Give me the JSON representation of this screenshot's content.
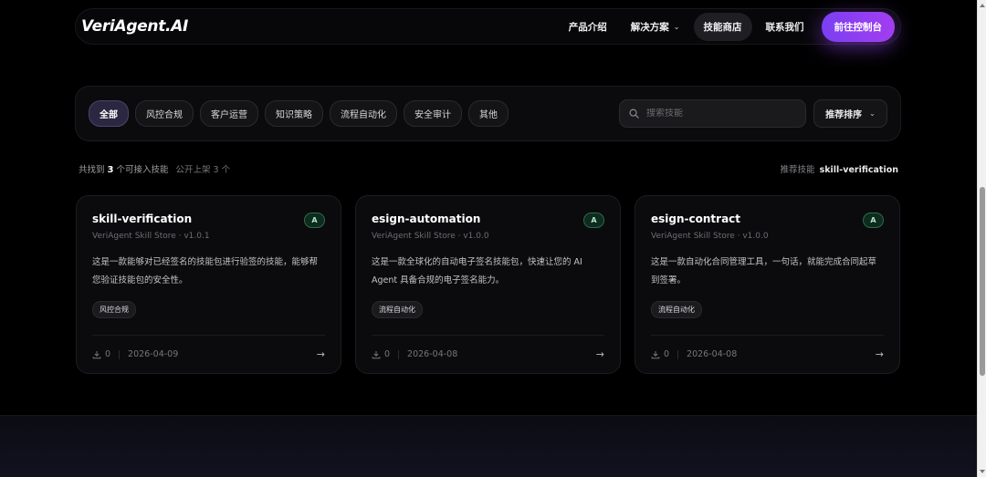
{
  "nav": {
    "logo": "VeriAgent.AI",
    "links": [
      {
        "label": "产品介绍"
      },
      {
        "label": "解决方案"
      },
      {
        "label": "技能商店"
      },
      {
        "label": "联系我们"
      }
    ],
    "cta": "前往控制台"
  },
  "filters": {
    "chips": [
      "全部",
      "风控合规",
      "客户运营",
      "知识策略",
      "流程自动化",
      "安全审计",
      "其他"
    ],
    "active": "全部",
    "search_placeholder": "搜索技能",
    "sort_label": "推荐排序"
  },
  "summary": {
    "prefix": "共找到",
    "count": "3",
    "suffix": "个可接入技能",
    "sub": "公开上架 3 个",
    "recommend_label": "推荐技能",
    "recommend_value": "skill-verification"
  },
  "cards": [
    {
      "title": "skill-verification",
      "badge": "A",
      "subtitle": "VeriAgent Skill Store · v1.0.1",
      "description": "这是一款能够对已经签名的技能包进行验签的技能，能够帮您验证技能包的安全性。",
      "tag": "风控合规",
      "downloads": "0",
      "date": "2026-04-09"
    },
    {
      "title": "esign-automation",
      "badge": "A",
      "subtitle": "VeriAgent Skill Store · v1.0.0",
      "description": "这是一款全球化的自动电子签名技能包，快速让您的 AI Agent 具备合规的电子签名能力。",
      "tag": "流程自动化",
      "downloads": "0",
      "date": "2026-04-08"
    },
    {
      "title": "esign-contract",
      "badge": "A",
      "subtitle": "VeriAgent Skill Store · v1.0.0",
      "description": "这是一款自动化合同管理工具，一句话，就能完成合同起草到签署。",
      "tag": "流程自动化",
      "downloads": "0",
      "date": "2026-04-08"
    }
  ],
  "colors": {
    "accent": "#8b3ff2",
    "badge_green": "#2a6d4a"
  }
}
